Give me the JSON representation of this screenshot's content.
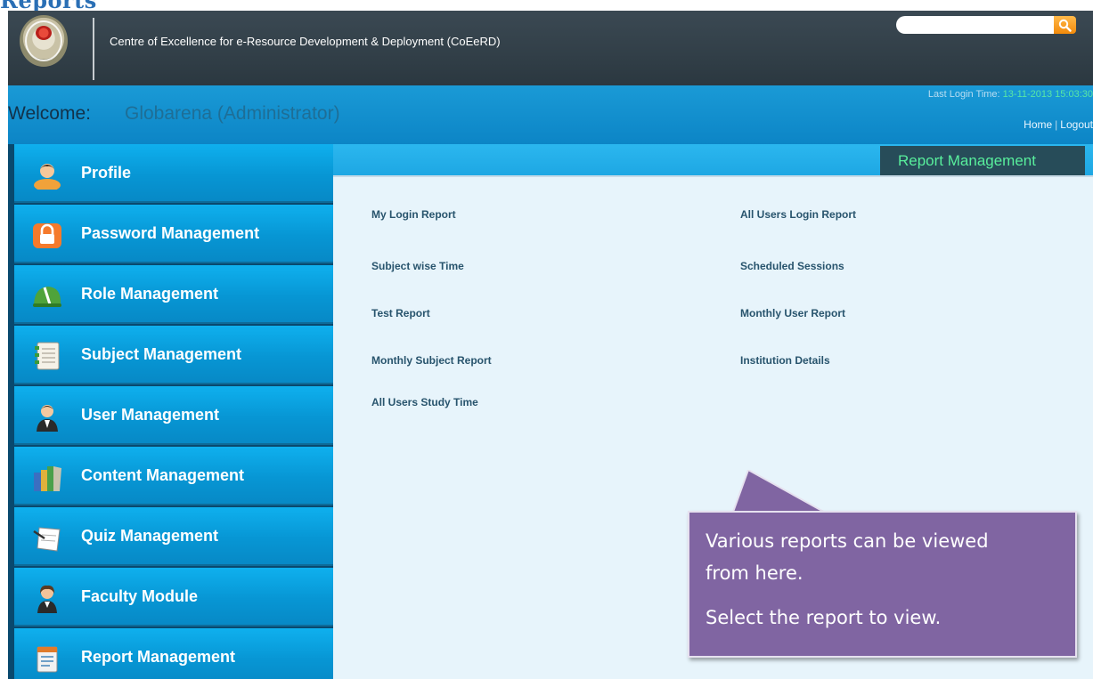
{
  "doc_heading": "Reports",
  "header": {
    "org_title": "Centre of Excellence for e-Resource Development & Deployment (CoEeRD)",
    "search": {
      "placeholder": "",
      "value": ""
    }
  },
  "welcome": {
    "label": "Welcome:",
    "user": "Globarena (Administrator)",
    "last_login_label": "Last Login Time:",
    "last_login_value": "13-11-2013 15:03:30",
    "home_link": "Home",
    "logout_link": "Logout"
  },
  "sidebar": {
    "items": [
      {
        "label": "Profile",
        "icon": "profile-icon"
      },
      {
        "label": "Password Management",
        "icon": "lock-icon"
      },
      {
        "label": "Role Management",
        "icon": "helmet-icon"
      },
      {
        "label": "Subject Management",
        "icon": "notebook-icon"
      },
      {
        "label": "User Management",
        "icon": "user-icon"
      },
      {
        "label": "Content Management",
        "icon": "books-icon"
      },
      {
        "label": "Quiz Management",
        "icon": "quiz-paper-icon"
      },
      {
        "label": "Faculty Module",
        "icon": "faculty-icon"
      },
      {
        "label": "Report Management",
        "icon": "report-icon"
      }
    ]
  },
  "main": {
    "section_title": "Report Management",
    "reports_left": [
      "My Login Report",
      "Subject wise Time",
      "Test Report",
      "Monthly Subject Report",
      "All Users Study Time"
    ],
    "reports_right": [
      "All Users Login Report",
      "Scheduled Sessions",
      "Monthly User Report",
      "Institution Details"
    ]
  },
  "callout": {
    "line1": "Various reports can be viewed",
    "line2": "from here.",
    "line3": "Select the report to view."
  },
  "colors": {
    "topbar": "#2f3d46",
    "welcome_bar": "#1394d2",
    "sidebar_item": "#0ba2e0",
    "section_tab_bg": "#274c59",
    "section_tab_text": "#58ee9c",
    "callout": "#8065a2",
    "search_button": "#f59a1a"
  }
}
